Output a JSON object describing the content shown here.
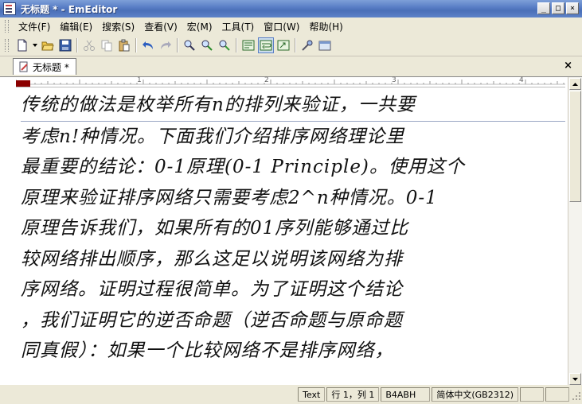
{
  "window": {
    "title": "无标题 * - EmEditor"
  },
  "window_controls": {
    "minimize": "_",
    "maximize": "□",
    "close": "×"
  },
  "menu": {
    "items": [
      {
        "label": "文件(F)"
      },
      {
        "label": "编辑(E)"
      },
      {
        "label": "搜索(S)"
      },
      {
        "label": "查看(V)"
      },
      {
        "label": "宏(M)"
      },
      {
        "label": "工具(T)"
      },
      {
        "label": "窗口(W)"
      },
      {
        "label": "帮助(H)"
      }
    ]
  },
  "tabs": {
    "active_label": "无标题 *",
    "close": "×"
  },
  "ruler": {
    "marks": [
      "1",
      "2",
      "3",
      "4"
    ]
  },
  "editor": {
    "lines": [
      "传统的做法是枚举所有n的排列来验证，一共要",
      "考虑n!种情况。下面我们介绍排序网络理论里",
      "最重要的结论：0-1原理(0-1 Principle)。使用这个",
      "原理来验证排序网络只需要考虑2^n种情况。0-1",
      "原理告诉我们，如果所有的01序列能够通过比",
      "较网络排出顺序，那么这足以说明该网络为排",
      "序网络。证明过程很简单。为了证明这个结论",
      "，我们证明它的逆否命题（逆否命题与原命题",
      "同真假）：如果一个比较网络不是排序网络，"
    ]
  },
  "status": {
    "mode": "Text",
    "position": "行 1，列 1",
    "code": "B4ABH",
    "encoding": "简体中文(GB2312)"
  }
}
